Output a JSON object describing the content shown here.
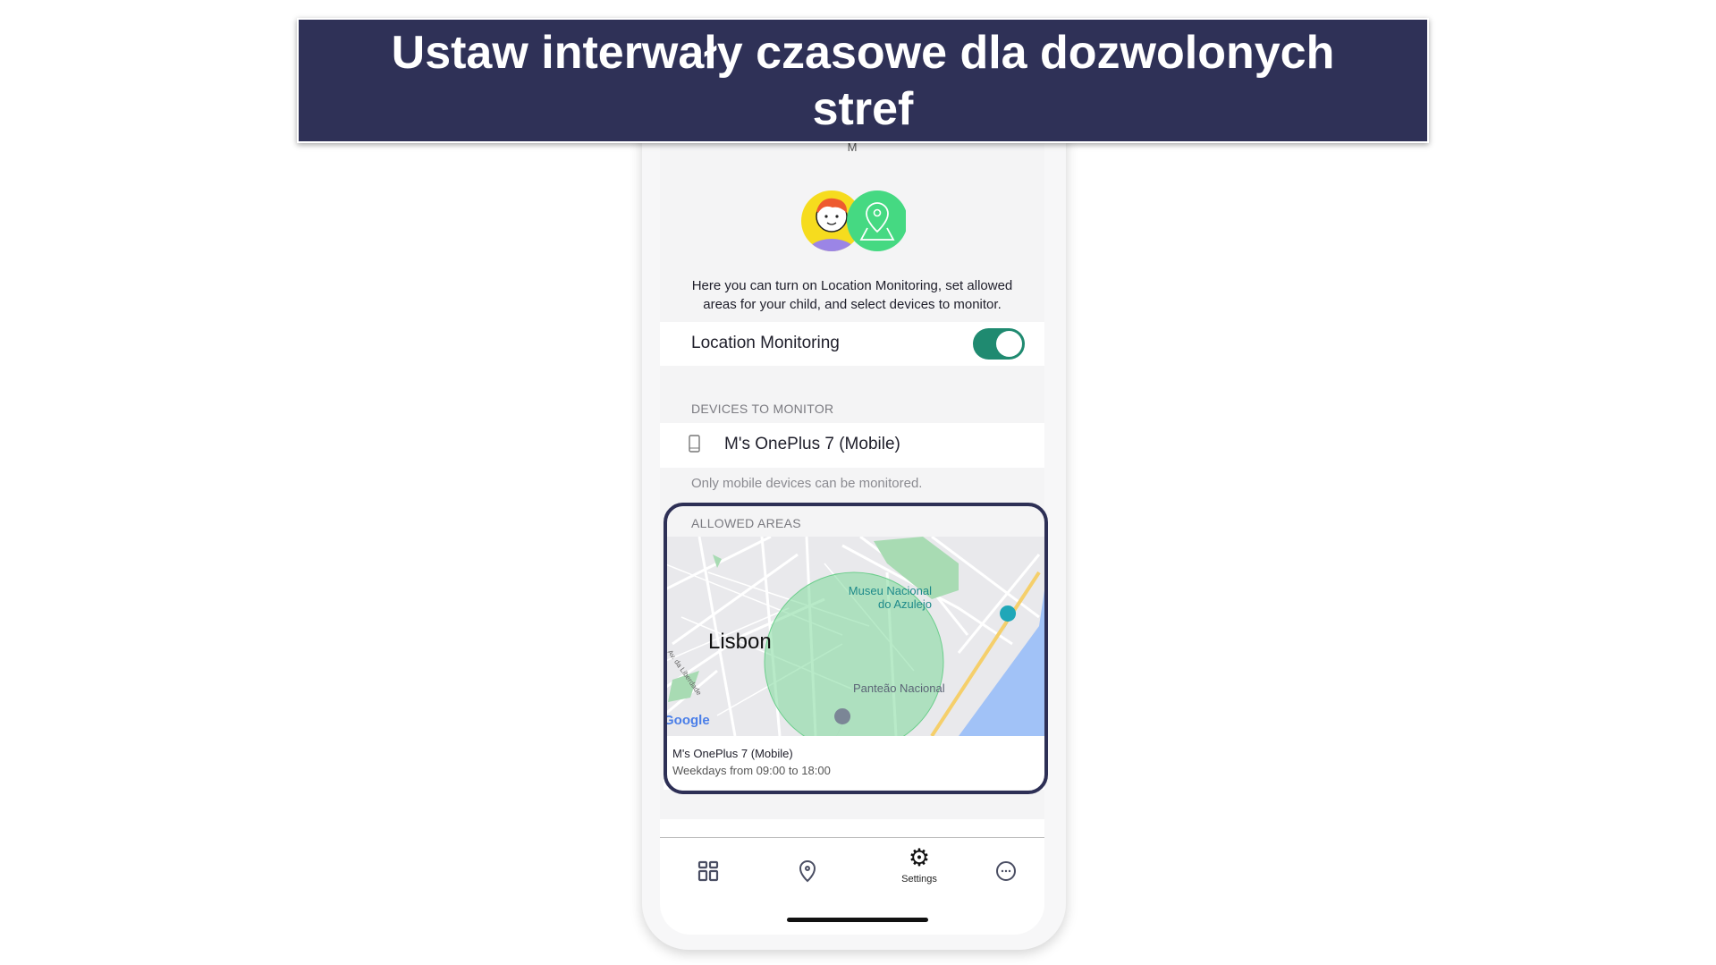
{
  "banner": {
    "line1": "Ustaw interwały czasowe dla dozwolonych",
    "line2": "stref"
  },
  "header": {
    "initial": "M"
  },
  "intro": {
    "description": "Here you can turn on Location Monitoring, set allowed areas for your child, and select devices to monitor."
  },
  "location_monitoring": {
    "label": "Location Monitoring",
    "enabled": true,
    "toggle_color": "#1f8a70"
  },
  "devices": {
    "section_label": "DEVICES TO MONITOR",
    "items": [
      {
        "name": "M's OnePlus 7 (Mobile)",
        "icon": "phone-icon"
      }
    ],
    "note": "Only mobile devices can be monitored."
  },
  "allowed_areas": {
    "section_label": "ALLOWED AREAS",
    "map": {
      "city": "Lisbon",
      "poi1_line1": "Museu Nacional",
      "poi1_line2": "do Azulejo",
      "poi2": "Panteão Nacional",
      "street": "Av. da Liberdade",
      "attribution": "Google"
    },
    "area": {
      "device": "M's OnePlus 7 (Mobile)",
      "schedule": "Weekdays from 09:00 to 18:00"
    }
  },
  "nav": {
    "items": [
      {
        "icon": "dashboard-icon",
        "label": ""
      },
      {
        "icon": "location-pin-icon",
        "label": ""
      },
      {
        "icon": "gear-icon",
        "label": "Settings",
        "active": true
      },
      {
        "icon": "more-icon",
        "label": ""
      }
    ]
  },
  "colors": {
    "banner": "#2f3157",
    "highlight": "#2d2f55",
    "accent": "#1f8a70"
  }
}
